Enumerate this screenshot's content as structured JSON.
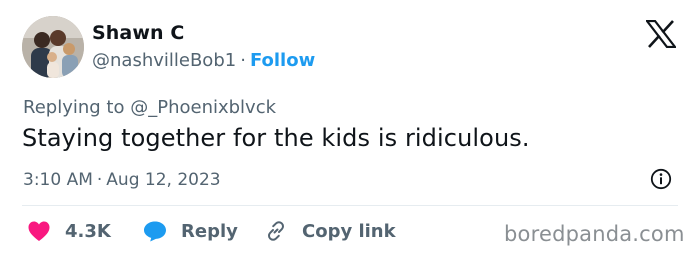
{
  "author": {
    "name": "Shawn C",
    "handle": "@nashvilleBob1",
    "separator": "·",
    "follow_label": "Follow"
  },
  "reply_context": {
    "prefix": "Replying to",
    "mention": "@_Phoenixblvck"
  },
  "tweet": {
    "text": "Staying together for the kids is ridiculous.",
    "time": "3:10 AM",
    "separator": "·",
    "date": "Aug 12, 2023"
  },
  "actions": {
    "like_count": "4.3K",
    "reply_label": "Reply",
    "copy_label": "Copy link"
  },
  "watermark": "boredpanda.com",
  "icons": {
    "brand": "x-logo-icon",
    "info": "info-icon",
    "like": "heart-icon",
    "reply": "speech-bubble-icon",
    "copy": "link-icon"
  },
  "colors": {
    "text_primary": "#0f1419",
    "text_secondary": "#536471",
    "follow_blue": "#1d9bf0",
    "like_pink": "#f91880",
    "reply_blue": "#1d9bf0",
    "divider": "#e6ecf0",
    "watermark": "#8a8f93"
  }
}
